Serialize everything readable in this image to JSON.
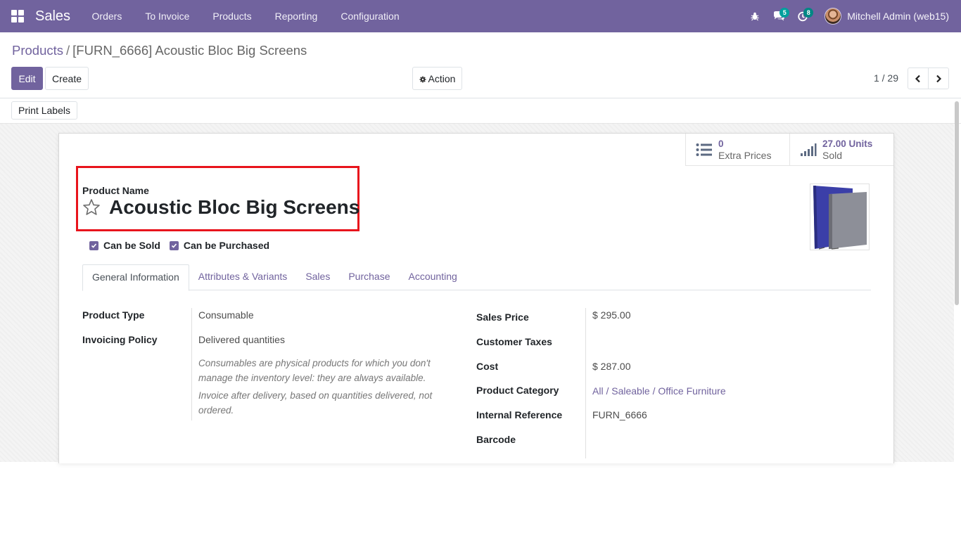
{
  "navbar": {
    "app_name": "Sales",
    "menu": [
      "Orders",
      "To Invoice",
      "Products",
      "Reporting",
      "Configuration"
    ],
    "messages_count": "5",
    "activities_count": "8",
    "user": "Mitchell Admin (web15)",
    "colors": {
      "bar": "#71639e",
      "messages_badge": "#00a09d",
      "activities_badge": "#008784"
    }
  },
  "breadcrumb": {
    "parent": "Products",
    "current": "[FURN_6666] Acoustic Bloc Big Screens"
  },
  "toolbar": {
    "edit_label": "Edit",
    "create_label": "Create",
    "action_label": "Action",
    "pager": "1 / 29"
  },
  "statusbar": {
    "print_labels": "Print Labels"
  },
  "smart_buttons": [
    {
      "value": "0",
      "label": "Extra Prices",
      "icon": "list-icon"
    },
    {
      "value": "27.00 Units",
      "label": "Sold",
      "icon": "bar-chart-icon"
    }
  ],
  "product": {
    "name_label": "Product Name",
    "name": "Acoustic Bloc Big Screens",
    "can_be_sold": "Can be Sold",
    "can_be_purchased": "Can be Purchased"
  },
  "tabs": [
    "General Information",
    "Attributes & Variants",
    "Sales",
    "Purchase",
    "Accounting"
  ],
  "general": {
    "left": {
      "product_type_label": "Product Type",
      "product_type": "Consumable",
      "invoicing_policy_label": "Invoicing Policy",
      "invoicing_policy": "Delivered quantities",
      "help_consumable": "Consumables are physical products for which you don't manage the inventory level: they are always available.",
      "help_invoice": "Invoice after delivery, based on quantities delivered, not ordered."
    },
    "right": {
      "sales_price_label": "Sales Price",
      "sales_price": "$ 295.00",
      "customer_taxes_label": "Customer Taxes",
      "cost_label": "Cost",
      "cost": "$ 287.00",
      "product_category_label": "Product Category",
      "product_category": "All / Saleable / Office Furniture",
      "internal_reference_label": "Internal Reference",
      "internal_reference": "FURN_6666",
      "barcode_label": "Barcode"
    }
  }
}
